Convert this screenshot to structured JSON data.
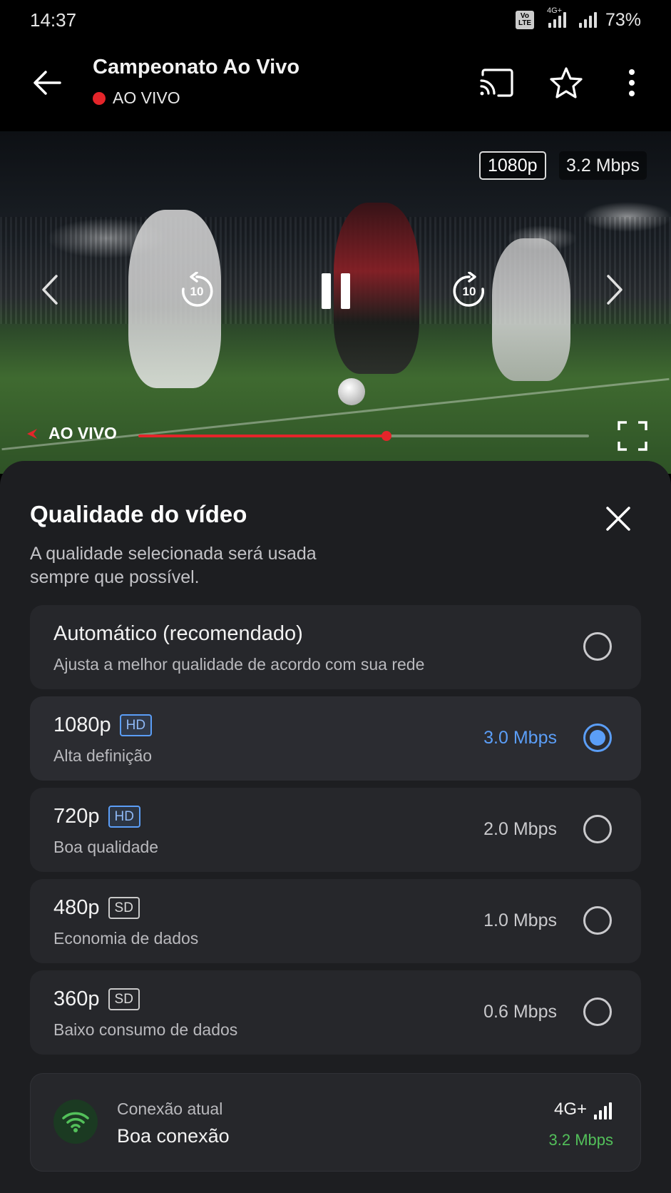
{
  "status_bar": {
    "time": "14:37",
    "volte": "Vo LTE",
    "network": "4G+",
    "battery": "73%"
  },
  "app_bar": {
    "title": "Campeonato Ao Vivo",
    "live_label": "AO VIVO",
    "icons": [
      "back-arrow-icon",
      "cast-icon",
      "star-icon",
      "more-vert-icon"
    ]
  },
  "player": {
    "quality": "1080p",
    "bitrate": "3.2 Mbps",
    "rewind_seconds": "10",
    "forward_seconds": "10",
    "live_label": "AO VIVO",
    "progress": 0.55,
    "colors": {
      "live_red": "#e4252a"
    }
  },
  "sheet": {
    "title": "Qualidade do vídeo",
    "description": "A qualidade selecionada será usada sempre que possível.",
    "options": [
      {
        "label": "Automático (recomendado)",
        "badge": "",
        "sub": "Ajusta a melhor qualidade de acordo com sua rede",
        "rate": "",
        "selected": false
      },
      {
        "label": "1080p",
        "badge": "HD",
        "sub": "Alta definição",
        "rate": "3.0 Mbps",
        "selected": true
      },
      {
        "label": "720p",
        "badge": "HD",
        "sub": "Boa qualidade",
        "rate": "2.0 Mbps",
        "selected": false
      },
      {
        "label": "480p",
        "badge": "SD",
        "sub": "Economia de dados",
        "rate": "1.0 Mbps",
        "selected": false
      },
      {
        "label": "360p",
        "badge": "SD",
        "sub": "Baixo consumo de dados",
        "rate": "0.6 Mbps",
        "selected": false
      }
    ],
    "connection": {
      "label": "Conexão atual",
      "value": "Boa conexão",
      "network": "4G+",
      "rate": "3.2 Mbps"
    },
    "colors": {
      "accent": "#5b9ef7",
      "good": "#53c05a",
      "background": "#1d1e21"
    }
  }
}
